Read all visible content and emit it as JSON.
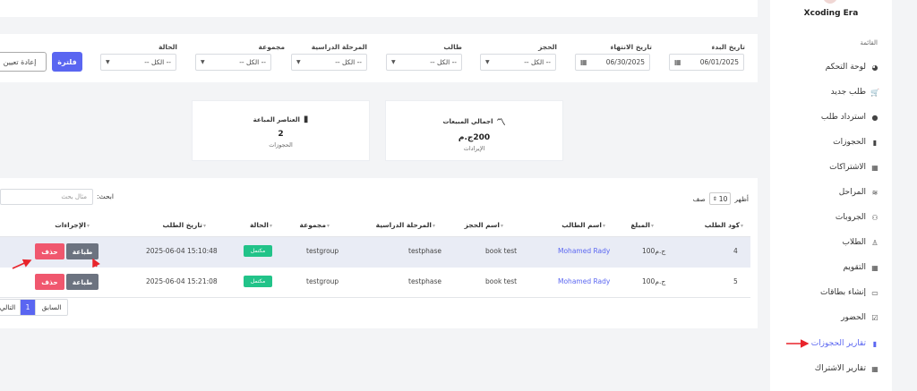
{
  "sidebar": {
    "brand": "Xcoding Era",
    "menu_label": "القائمة",
    "items": [
      {
        "label": "لوحة التحكم",
        "icon": "palette-icon",
        "glyph": "◕"
      },
      {
        "label": "طلب جديد",
        "icon": "cart-icon",
        "glyph": "🛒"
      },
      {
        "label": "استرداد طلب",
        "icon": "circle-icon",
        "glyph": "●"
      },
      {
        "label": "الحجوزات",
        "icon": "book-icon",
        "glyph": "▮"
      },
      {
        "label": "الاشتراكات",
        "icon": "calendar-icon",
        "glyph": "▦"
      },
      {
        "label": "المراحل",
        "icon": "layers-icon",
        "glyph": "≋"
      },
      {
        "label": "الجروبات",
        "icon": "users-icon",
        "glyph": "⚇"
      },
      {
        "label": "الطلاب",
        "icon": "user-graduate-icon",
        "glyph": "♙"
      },
      {
        "label": "التقويم",
        "icon": "calendar-icon",
        "glyph": "▦"
      },
      {
        "label": "إنشاء بطاقات",
        "icon": "id-card-icon",
        "glyph": "▭"
      },
      {
        "label": "الحضور",
        "icon": "calendar-check-icon",
        "glyph": "☑"
      },
      {
        "label": "تقارير الحجوزات",
        "icon": "book-icon",
        "glyph": "▮",
        "active": true
      },
      {
        "label": "تقارير الاشتراك",
        "icon": "calendar-icon",
        "glyph": "▦"
      }
    ]
  },
  "filters": {
    "start_date": {
      "label": "تاريخ البدء",
      "value": "06/01/2025"
    },
    "end_date": {
      "label": "تاريخ الانتهاء",
      "value": "06/30/2025"
    },
    "booking": {
      "label": "الحجز",
      "value": "-- الكل --"
    },
    "student": {
      "label": "طالب",
      "value": "-- الكل --"
    },
    "phase": {
      "label": "المرحلة الدراسية",
      "value": "-- الكل --"
    },
    "group": {
      "label": "مجموعة",
      "value": "-- الكل --"
    },
    "status": {
      "label": "الحالة",
      "value": "-- الكل --"
    },
    "filter_button": "فلترة",
    "reset_button": "إعادة تعيين"
  },
  "summary": {
    "sales": {
      "title": "اجمالي المبيعات",
      "value": "200ج.م",
      "sub": "الإيرادات",
      "icon": "chart-line-icon"
    },
    "items": {
      "title": "العناصر المباعة",
      "value": "2",
      "sub": "الحجوزات",
      "icon": "book-icon"
    }
  },
  "table": {
    "show_prefix": "أظهر",
    "length": "10",
    "show_suffix": "صف",
    "search_label": "ابحث:",
    "search_placeholder": "مثال بحث",
    "columns": [
      "كود الطلب",
      "المبلغ",
      "اسم الطالب",
      "اسم الحجز",
      "المرحلة الدراسية",
      "مجموعة",
      "الحالة",
      "تاريخ الطلب",
      "الإجراءات"
    ],
    "rows": [
      {
        "id": "4",
        "amount": "100ج.م",
        "student": "Mohamed Rady",
        "booking": "book test",
        "phase": "testphase",
        "group": "testgroup",
        "status": "مكتمل",
        "date": "2025-06-04 15:10:48"
      },
      {
        "id": "5",
        "amount": "100ج.م",
        "student": "Mohamed Rady",
        "booking": "book test",
        "phase": "testphase",
        "group": "testgroup",
        "status": "مكتمل",
        "date": "2025-06-04 15:21:08"
      }
    ],
    "print_label": "طباعة",
    "delete_label": "حذف",
    "pagination": {
      "prev": "السابق",
      "current": "1",
      "next": "التالي"
    }
  },
  "colors": {
    "accent": "#5a66f1",
    "success": "#22c389",
    "danger": "#f0576e",
    "muted_button": "#6c7380",
    "annotation": "#e8242b"
  }
}
